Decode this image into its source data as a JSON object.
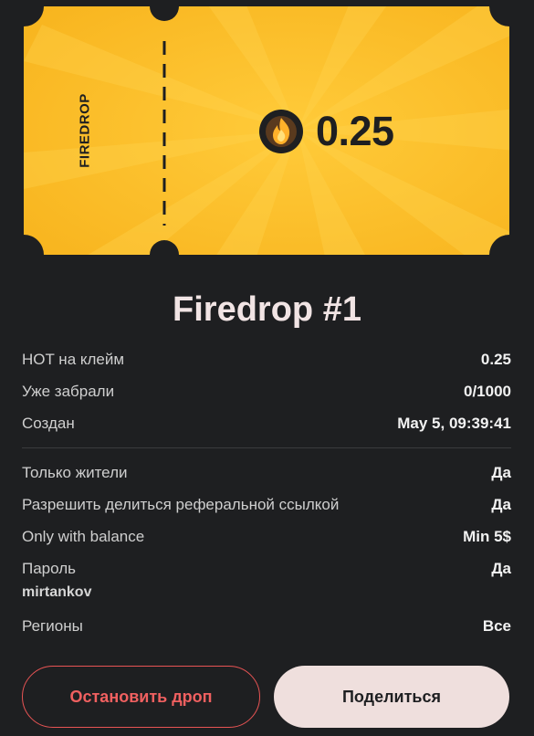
{
  "ticket": {
    "side_label": "FIREDROP",
    "amount": "0.25",
    "coin_icon": "hot-flame-coin-icon",
    "colors": {
      "ticket": "#ffc12e",
      "ink": "#1e1f21"
    }
  },
  "title": "Firedrop #1",
  "details": {
    "hot_claim": {
      "label": "HOT на клейм",
      "value": "0.25"
    },
    "claimed": {
      "label": "Уже забрали",
      "value": "0/1000"
    },
    "created": {
      "label": "Создан",
      "value": "May 5, 09:39:41"
    }
  },
  "conditions": {
    "residents_only": {
      "label": "Только жители",
      "value": "Да"
    },
    "referral_share": {
      "label": "Разрешить делиться реферальной ссылкой",
      "value": "Да"
    },
    "balance": {
      "label": "Only with balance",
      "value": "Min 5$"
    },
    "password": {
      "label": "Пароль",
      "value": "Да",
      "sub": "mirtankov"
    },
    "regions": {
      "label": "Регионы",
      "value": "Все"
    }
  },
  "actions": {
    "stop_label": "Остановить дроп",
    "share_label": "Поделиться"
  },
  "colors": {
    "background": "#1e1f21",
    "accent_red": "#e85454",
    "share_bg": "#efdfdd"
  }
}
